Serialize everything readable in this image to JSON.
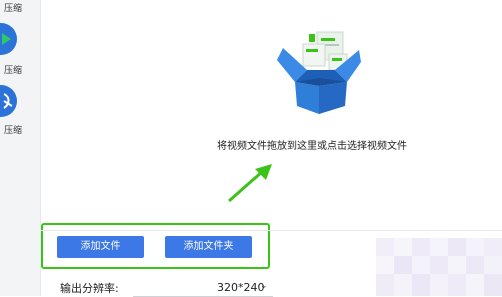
{
  "sidebar": {
    "items": [
      {
        "label": "压缩",
        "icon": "compress-icon"
      },
      {
        "label": "压缩",
        "icon": "video-compress-icon"
      },
      {
        "label": "压缩",
        "icon": "pdf-compress-icon"
      }
    ]
  },
  "dropzone": {
    "instruction": "将视频文件拖放到这里或点击选择视频文件",
    "icon": "open-box-icon"
  },
  "actions": {
    "add_file": "添加文件",
    "add_folder": "添加文件夹"
  },
  "settings": {
    "resolution_label": "输出分辨率:",
    "resolution_value": "320*240"
  },
  "colors": {
    "accent": "#3c78e6",
    "highlight": "#3cc31a",
    "box": "#2f7fd9",
    "sidebar_icon": "#2b73d8"
  }
}
